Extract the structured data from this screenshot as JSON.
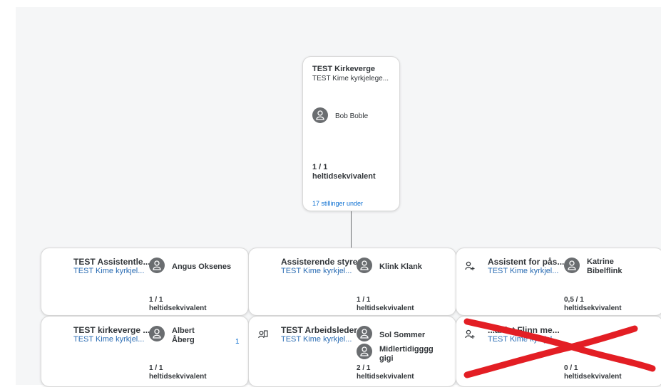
{
  "top": {
    "title": "TEST Kirkeverge",
    "subtitle": "TEST Kime kyrkjelege...",
    "person": "Bob Boble",
    "fte_value": "1 / 1",
    "fte_label": "heltidsekvivalent",
    "link": "17 stillinger under"
  },
  "cards": [
    {
      "title": "TEST Assistentle...",
      "subtitle": "TEST Kime kyrkjel...",
      "person1": "Angus Oksenes",
      "fte_value": "1 / 1",
      "fte_label": "heltidsekvivalent"
    },
    {
      "title": "Assisterende styrer",
      "subtitle": "TEST Kime kyrkjel...",
      "person1": "Klink Klank",
      "fte_value": "1 / 1",
      "fte_label": "heltidsekvivalent"
    },
    {
      "title": "Assistent for pås...",
      "subtitle": "TEST Kime kyrkjel...",
      "person1": "Katrine Bibelflink",
      "fte_value": "0,5 / 1",
      "fte_label": "heltidsekvivalent",
      "icon": "add-person-icon"
    },
    {
      "title": "TEST kirkeverge ...",
      "subtitle": "TEST Kime kyrkjel...",
      "person1": "Albert Åberg",
      "badge": "1",
      "fte_value": "1 / 1",
      "fte_label": "heltidsekvivalent"
    },
    {
      "title": "TEST Arbeidsleder",
      "subtitle": "TEST Kime kyrkjel...",
      "person1": "Sol Sommer",
      "person2": "Midlertidigggg gigi",
      "fte_value": "2 / 1",
      "fte_label": "heltidsekvivalent",
      "icon": "multi-person-icon"
    },
    {
      "title": "...anist Flinn me...",
      "subtitle": "TEST Kime kyrkjel...",
      "fte_value": "0 / 1",
      "fte_label": "heltidsekvivalent",
      "icon": "add-person-icon"
    }
  ],
  "colors": {
    "accent": "#0a6ed1",
    "link": "#2a6cb3",
    "scribble": "#e31e24"
  }
}
